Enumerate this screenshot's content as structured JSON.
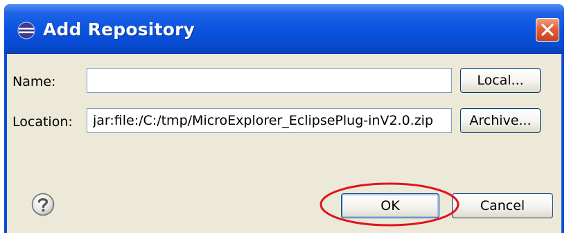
{
  "window": {
    "title": "Add Repository",
    "icons": {
      "app": "eclipse-icon",
      "close": "close-icon",
      "help": "help-icon"
    }
  },
  "form": {
    "name_label": "Name:",
    "name_value": "",
    "location_label": "Location:",
    "location_value": "jar:file:/C:/tmp/MicroExplorer_EclipsePlug-inV2.0.zip"
  },
  "buttons": {
    "local": "Local...",
    "archive": "Archive...",
    "ok": "OK",
    "cancel": "Cancel"
  },
  "colors": {
    "titlebar": "#0b54e0",
    "dialog_bg": "#ece9d8",
    "annotation": "#e0141e"
  }
}
